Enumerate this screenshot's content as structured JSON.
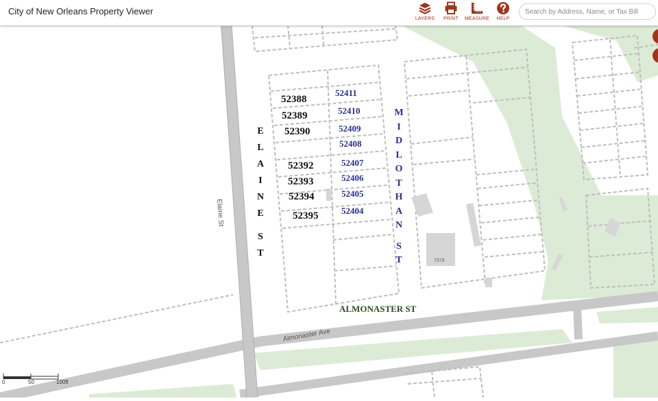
{
  "header": {
    "title": "City of New Orleans Property Viewer",
    "tools": [
      {
        "label": "LAYERS",
        "icon": "layers-icon"
      },
      {
        "label": "PRINT",
        "icon": "printer-icon"
      },
      {
        "label": "MEASURE",
        "icon": "ruler-icon"
      },
      {
        "label": "HELP",
        "icon": "help-icon"
      }
    ],
    "search": {
      "placeholder": "Search by Address, Name, or Tax Bill",
      "value": ""
    }
  },
  "map": {
    "streets": {
      "elaine_vertical": [
        "E",
        "L",
        "A",
        "I",
        "N",
        "E",
        "S",
        "T"
      ],
      "elaine_map": "Elaine St",
      "midlothan_vertical": [
        "M",
        "I",
        "D",
        "L",
        "O",
        "T",
        "H",
        "A",
        "N",
        "S",
        "T"
      ],
      "almonaster_st": "ALMONASTER ST",
      "almonaster_ave": "Almonaster Ave"
    },
    "lots_left": [
      "52388",
      "52389",
      "52390",
      "52392",
      "52393",
      "52394",
      "52395"
    ],
    "lots_right": [
      "52411",
      "52410",
      "52409",
      "52408",
      "52407",
      "52406",
      "52405",
      "52404"
    ],
    "building_address": "7979",
    "scale": {
      "labels": [
        "0",
        "50",
        "100ft"
      ]
    },
    "colors": {
      "accent": "#a0341c",
      "park": "#d9ead3",
      "road": "#c8c8c8",
      "lot_left": "#111111",
      "lot_right": "#2a2f8f"
    }
  }
}
